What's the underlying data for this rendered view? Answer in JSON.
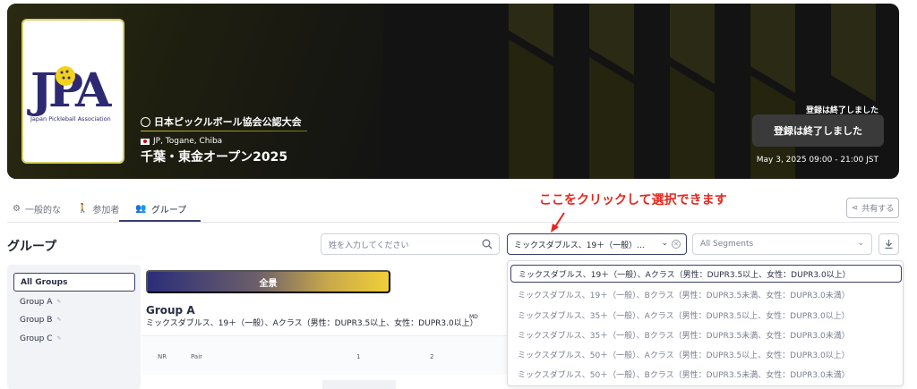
{
  "event": {
    "certification": "日本ピックルボール協会公認大会",
    "location": "JP, Togane, Chiba",
    "title": "千葉・東金オープン2025",
    "registration_status": "登録は終了しました",
    "registration_button": "登録は終了しました",
    "datetime": "May 3, 2025 09:00 - 21:00 JST",
    "logo": {
      "letters": "JPA",
      "caption": "Japan Pickleball Association"
    }
  },
  "tabs": [
    {
      "label": "一般的な",
      "icon": "gear-icon"
    },
    {
      "label": "参加者",
      "icon": "person-walking-icon"
    },
    {
      "label": "グループ",
      "icon": "people-icon"
    }
  ],
  "annotation": "ここをクリックして選択できます",
  "share_label": "共有する",
  "section_title": "グループ",
  "search": {
    "placeholder": "姓を入力してください",
    "value": ""
  },
  "division_select": {
    "value": "ミックスダブルス、19＋（一般）..."
  },
  "segments": {
    "placeholder": "All Segments"
  },
  "sidebar": {
    "items": [
      {
        "label": "All Groups"
      },
      {
        "label": "Group A"
      },
      {
        "label": "Group B"
      },
      {
        "label": "Group C"
      }
    ]
  },
  "main": {
    "pill": "全景",
    "group_title": "Group A",
    "group_subtitle": "ミックスダブルス、19＋（一般）、Aクラス（男性：DUPR3.5以上、女性：DUPR3.0以上）",
    "group_badge": "MD",
    "columns": [
      "NR",
      "Pair",
      "1",
      "2"
    ]
  },
  "dropdown_options": [
    "ミックスダブルス、19＋（一般）、Aクラス（男性：DUPR3.5以上、女性：DUPR3.0以上）",
    "ミックスダブルス、19＋（一般）、Bクラス（男性：DUPR3.5未満、女性：DUPR3.0未満）",
    "ミックスダブルス、35＋（一般）、Aクラス（男性：DUPR3.5以上、女性：DUPR3.0以上）",
    "ミックスダブルス、35＋（一般）、Bクラス（男性：DUPR3.5未満、女性：DUPR3.0未満）",
    "ミックスダブルス、50＋（一般）、Aクラス（男性：DUPR3.5以上、女性：DUPR3.0以上）",
    "ミックスダブルス、50＋（一般）、Bクラス（男性：DUPR3.5未満、女性：DUPR3.0未満）"
  ],
  "colors": {
    "banner_bg": "#131313",
    "accent_gold": "#d8cf63",
    "brand_navy": "#3a3f6e",
    "annotation_red": "#e8261c"
  }
}
